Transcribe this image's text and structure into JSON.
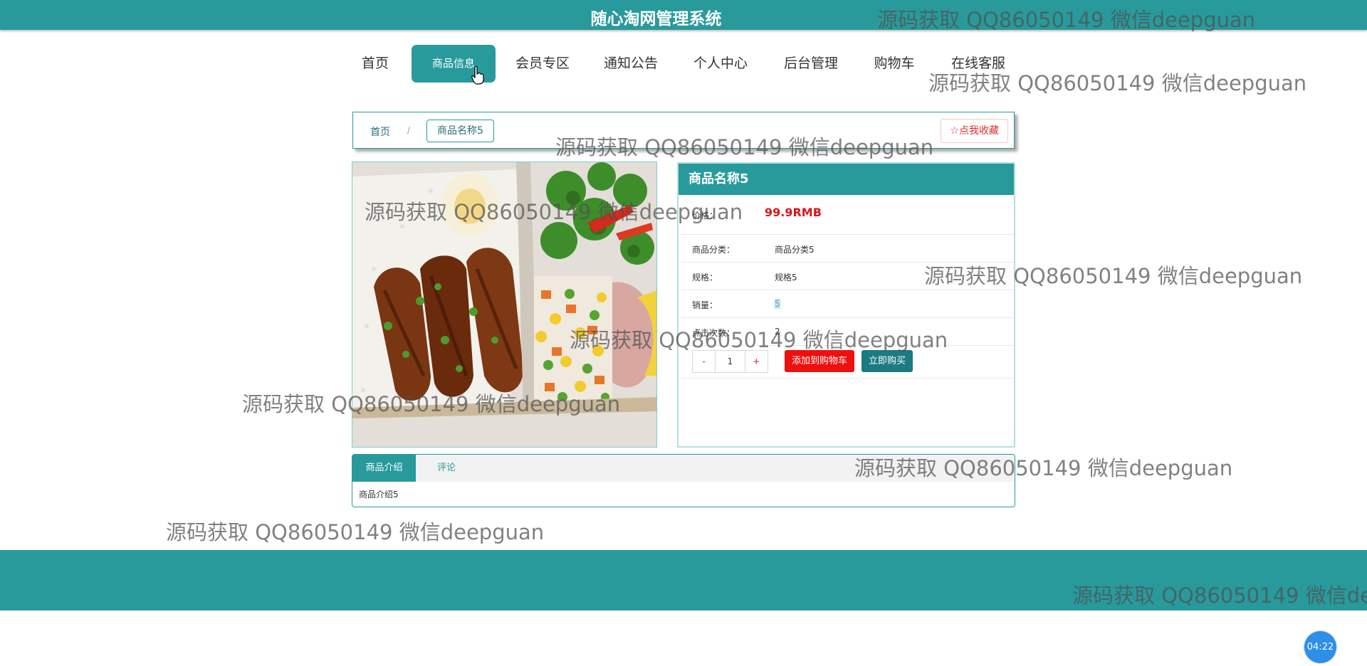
{
  "header": {
    "title": "随心淘网管理系统"
  },
  "nav": {
    "items": [
      {
        "label": "首页"
      },
      {
        "label": "商品信息"
      },
      {
        "label": "会员专区"
      },
      {
        "label": "通知公告"
      },
      {
        "label": "个人中心"
      },
      {
        "label": "后台管理"
      },
      {
        "label": "购物车"
      },
      {
        "label": "在线客服"
      }
    ],
    "active_index": 1
  },
  "breadcrumb": {
    "home": "首页",
    "separator": "/",
    "current": "商品名称5",
    "favorite_label": "☆点我收藏"
  },
  "product": {
    "name": "商品名称5",
    "price_label": "价格：",
    "price": "99.9RMB",
    "category_label": "商品分类：",
    "category": "商品分类5",
    "spec_label": "规格：",
    "spec": "规格5",
    "sales_label": "销量：",
    "sales": "5",
    "clicks_label": "点击次数：",
    "clicks": "2",
    "quantity": "1",
    "minus": "-",
    "plus": "+",
    "add_to_cart": "添加到购物车",
    "buy_now": "立即购买"
  },
  "tabs": {
    "items": [
      {
        "label": "商品介绍"
      },
      {
        "label": "评论"
      }
    ],
    "content": "商品介绍5"
  },
  "timer": "04:22",
  "watermark": "源码获取 QQ86050149 微信deepguan",
  "colors": {
    "primary": "#289a9c",
    "price": "#d8151c",
    "cart_button": "#ee0f0f",
    "buy_button": "#1b7a82"
  }
}
